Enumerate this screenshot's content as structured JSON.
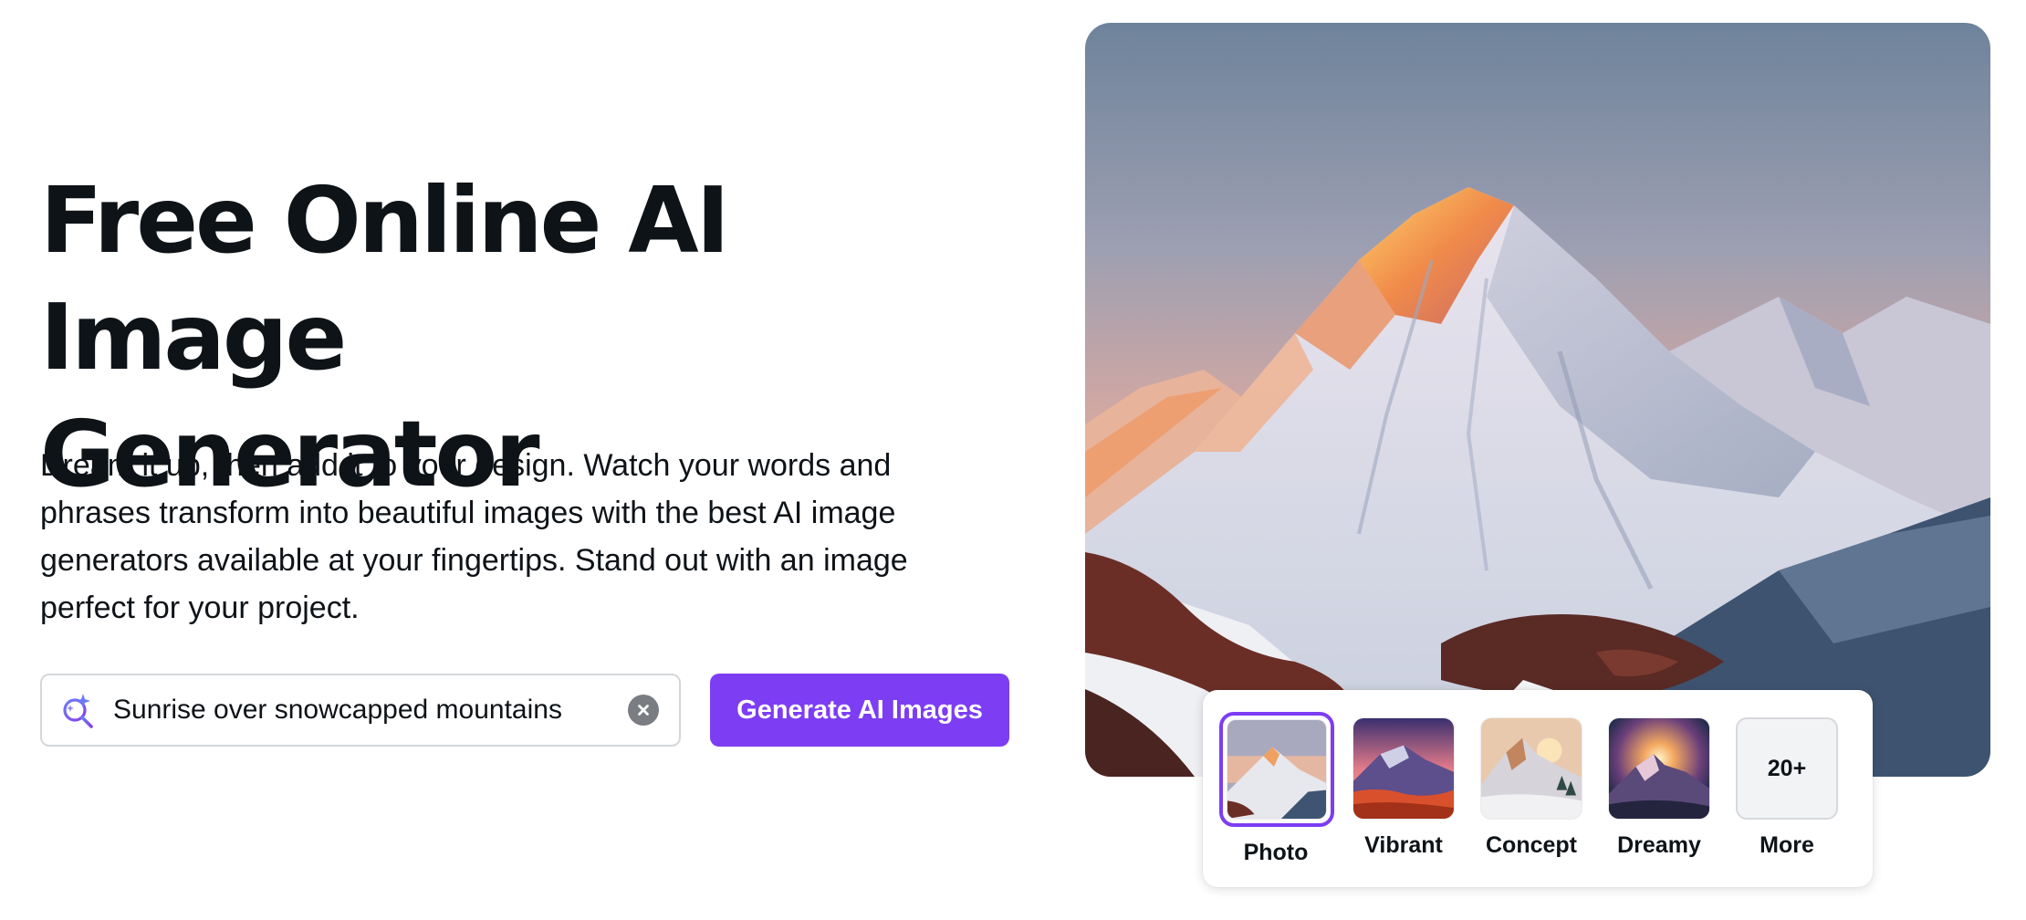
{
  "hero": {
    "title_line1": "Free Online AI Image",
    "title_line2": "Generator",
    "description": "Dream it up, then add it to your design. Watch your words and phrases transform into beautiful images with the best AI image generators available at your fingertips. Stand out with an image perfect for your project."
  },
  "search": {
    "value": "Sunrise over snowcapped mountains",
    "icon": "ai-search-icon",
    "clear_icon": "clear-icon"
  },
  "generate_button": {
    "label": "Generate AI Images"
  },
  "preview_image": {
    "subject": "mountain-sunrise-image"
  },
  "styles": {
    "selected": "Photo",
    "items": [
      {
        "label": "Photo"
      },
      {
        "label": "Vibrant"
      },
      {
        "label": "Concept"
      },
      {
        "label": "Dreamy"
      },
      {
        "label": "More",
        "badge": "20+"
      }
    ]
  },
  "colors": {
    "accent": "#7d3df3",
    "text": "#0e1318",
    "input_border": "#d4d6da"
  }
}
